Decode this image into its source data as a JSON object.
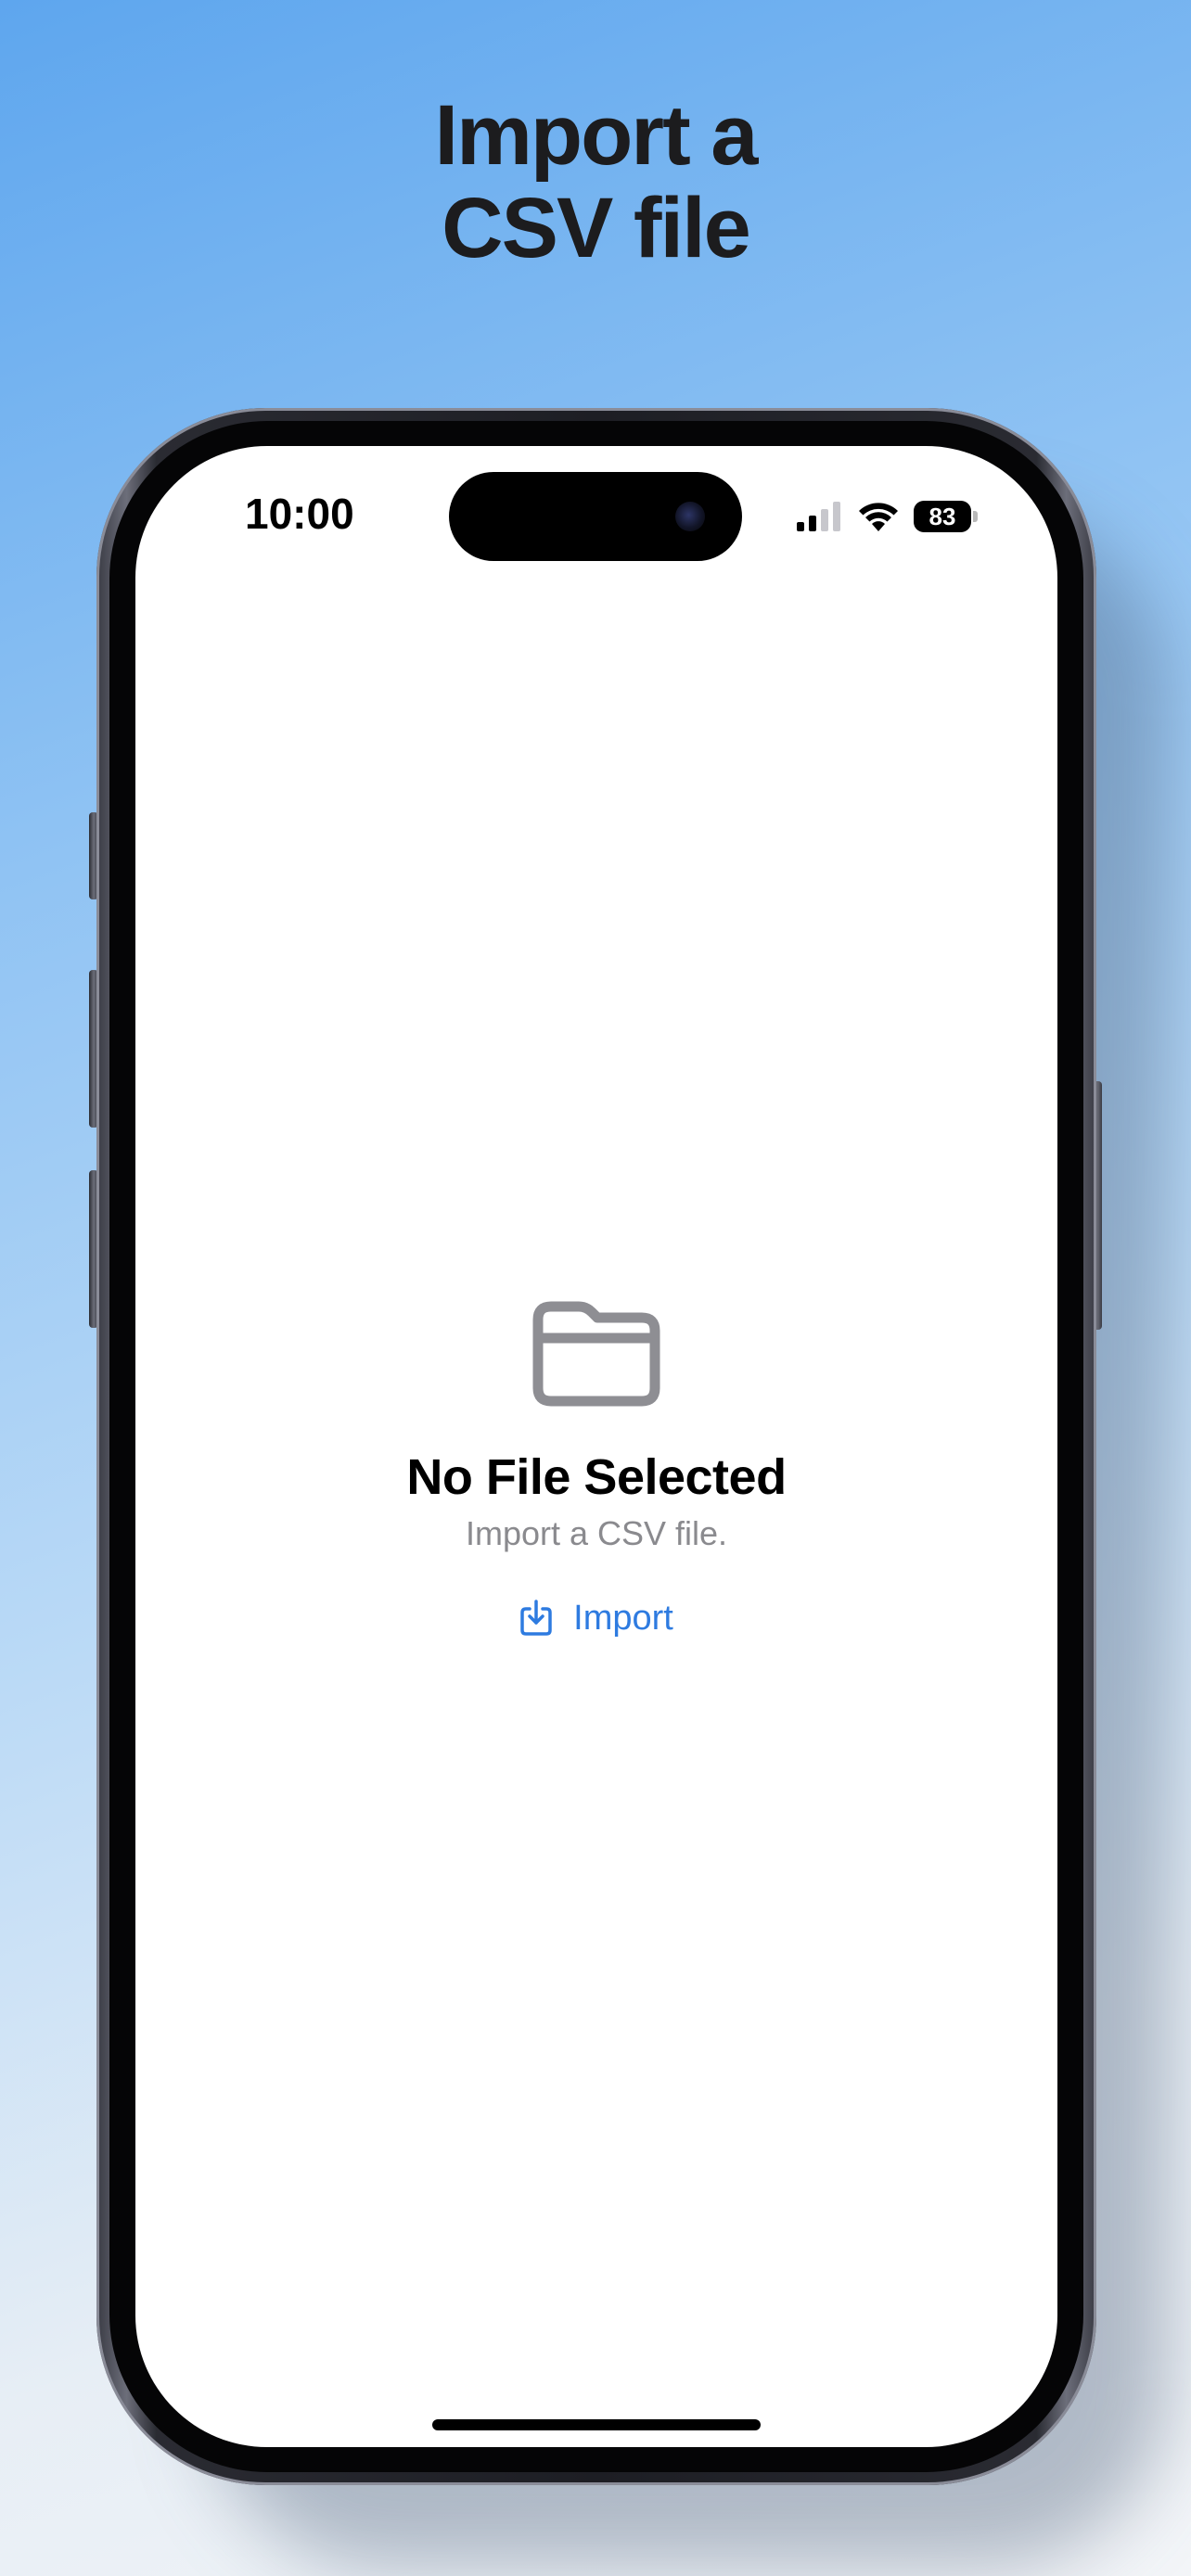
{
  "headline": {
    "line1": "Import a",
    "line2": "CSV file"
  },
  "status_bar": {
    "time": "10:00",
    "battery_level": "83",
    "signal_bars_active": 2,
    "signal_bars_total": 4,
    "icons": [
      "cellular-signal-icon",
      "wifi-icon",
      "battery-icon"
    ]
  },
  "empty_state": {
    "icon": "folder-icon",
    "title": "No File Selected",
    "subtitle": "Import a CSV file.",
    "action_label": "Import",
    "action_icon": "import-tray-icon"
  },
  "colors": {
    "accent": "#2e7be0",
    "secondary_text": "#8a8a8e",
    "icon_gray": "#8e8e93",
    "background_top": "#5ea6ee",
    "background_bottom": "#f3f5f8"
  }
}
